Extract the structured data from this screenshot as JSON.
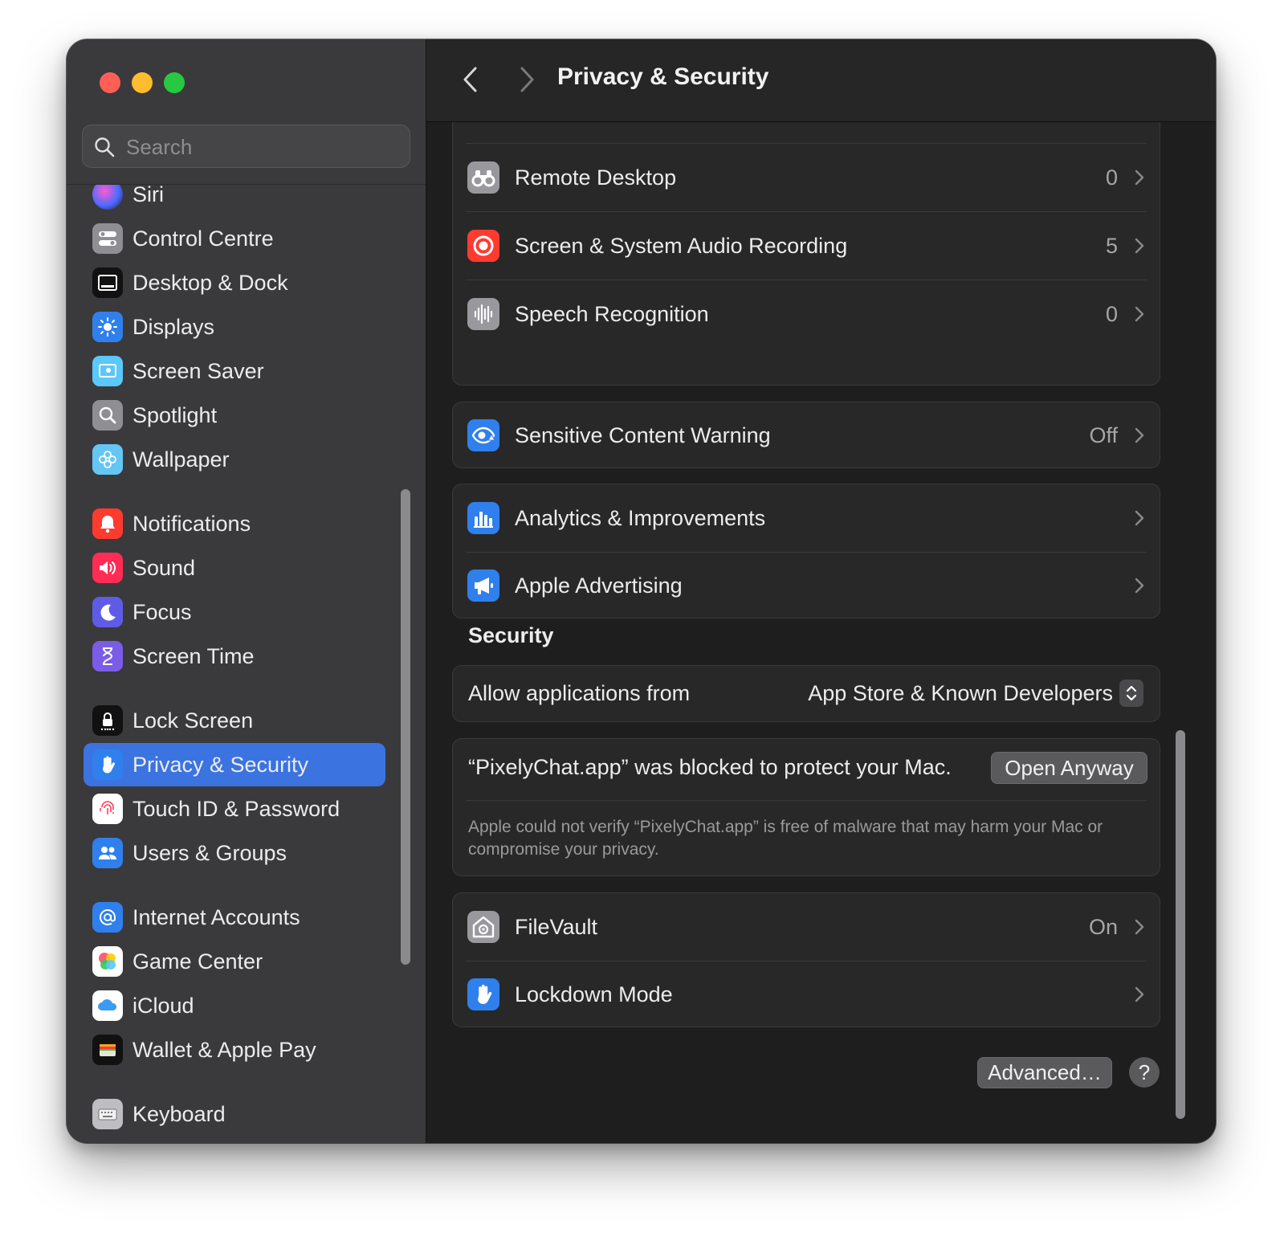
{
  "window": {
    "title": "Privacy & Security"
  },
  "search": {
    "placeholder": "Search"
  },
  "sidebar": {
    "items": [
      {
        "label": "Siri",
        "icon": "siri-icon"
      },
      {
        "label": "Control Centre",
        "icon": "control-centre-icon"
      },
      {
        "label": "Desktop & Dock",
        "icon": "desktop-dock-icon"
      },
      {
        "label": "Displays",
        "icon": "displays-icon"
      },
      {
        "label": "Screen Saver",
        "icon": "screen-saver-icon"
      },
      {
        "label": "Spotlight",
        "icon": "spotlight-icon"
      },
      {
        "label": "Wallpaper",
        "icon": "wallpaper-icon"
      },
      {
        "label": "Notifications",
        "icon": "notifications-icon"
      },
      {
        "label": "Sound",
        "icon": "sound-icon"
      },
      {
        "label": "Focus",
        "icon": "focus-icon"
      },
      {
        "label": "Screen Time",
        "icon": "screen-time-icon"
      },
      {
        "label": "Lock Screen",
        "icon": "lock-screen-icon"
      },
      {
        "label": "Privacy & Security",
        "icon": "privacy-hand-icon",
        "selected": true
      },
      {
        "label": "Touch ID & Password",
        "icon": "fingerprint-icon"
      },
      {
        "label": "Users & Groups",
        "icon": "users-groups-icon"
      },
      {
        "label": "Internet Accounts",
        "icon": "internet-accounts-icon"
      },
      {
        "label": "Game Center",
        "icon": "game-center-icon"
      },
      {
        "label": "iCloud",
        "icon": "icloud-icon"
      },
      {
        "label": "Wallet & Apple Pay",
        "icon": "wallet-icon"
      },
      {
        "label": "Keyboard",
        "icon": "keyboard-icon"
      }
    ]
  },
  "privacy": {
    "rows": [
      {
        "label": "Remote Desktop",
        "value": "0",
        "icon": "binoculars-icon"
      },
      {
        "label": "Screen & System Audio Recording",
        "value": "5",
        "icon": "record-icon"
      },
      {
        "label": "Speech Recognition",
        "value": "0",
        "icon": "waveform-icon"
      }
    ],
    "sensitive": {
      "label": "Sensitive Content Warning",
      "value": "Off",
      "icon": "eye-warning-icon"
    },
    "analytics": [
      {
        "label": "Analytics & Improvements",
        "icon": "analytics-icon"
      },
      {
        "label": "Apple Advertising",
        "icon": "megaphone-icon"
      }
    ]
  },
  "security": {
    "title": "Security",
    "allow_label": "Allow applications from",
    "allow_value": "App Store & Known Developers",
    "blocked_message": "“PixelyChat.app” was blocked to protect your Mac.",
    "open_anyway": "Open Anyway",
    "blocked_detail": "Apple could not verify “PixelyChat.app” is free of malware that may harm your Mac or compromise your privacy.",
    "filevault": {
      "label": "FileVault",
      "value": "On",
      "icon": "filevault-icon"
    },
    "lockdown": {
      "label": "Lockdown Mode",
      "icon": "lockdown-hand-icon"
    },
    "advanced_label": "Advanced…",
    "help_label": "?"
  },
  "colors": {
    "accent": "#3b73e0",
    "close": "#ff5f57",
    "minimize": "#febc2e",
    "zoom": "#28c840"
  }
}
